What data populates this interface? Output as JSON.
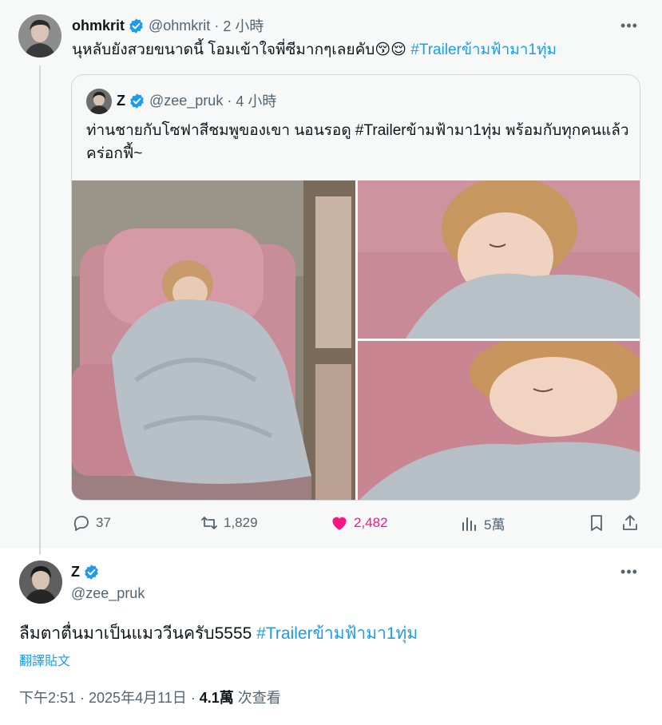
{
  "tweet1": {
    "name": "ohmkrit",
    "handle": "@ohmkrit",
    "time": "2 小時",
    "text": "นุหลับยังสวยขนาดนี้ โอมเข้าใจพี่ซีมากๆเลยคับ",
    "emojis": "😚😌",
    "hashtag": "#Trailerข้ามฟ้ามา1ทุ่ม"
  },
  "quote": {
    "name": "Z",
    "handle": "@zee_pruk",
    "time": "4 小時",
    "text": "ท่านชายกับโซฟาสีชมพูของเขา นอนรอดู #Trailerข้ามฟ้ามา1ทุ่ม พร้อมกับทุกคนแล้ว คร่อกฟี้~"
  },
  "actions": {
    "replies": "37",
    "retweets": "1,829",
    "likes": "2,482",
    "views": "5萬"
  },
  "tweet2": {
    "name": "Z",
    "handle": "@zee_pruk",
    "text": "ลืมตาตื่นมาเป็นแมววีนครับ5555",
    "hashtag": "#Trailerข้ามฟ้ามา1ทุ่ม",
    "translate": "翻譯貼文",
    "timestamp": "下午2:51 · 2025年4月11日 · ",
    "views_count": "4.1萬",
    "views_label": " 次查看"
  },
  "colors": {
    "accent": "#1d9bf0",
    "like": "#f91880",
    "muted": "#536471",
    "text": "#0f1419"
  }
}
